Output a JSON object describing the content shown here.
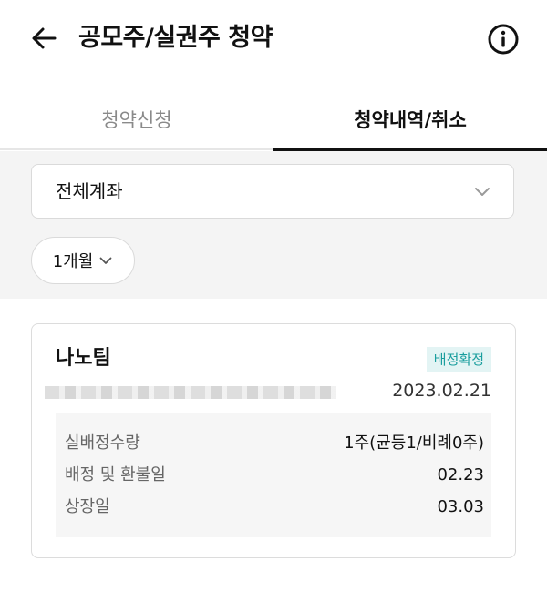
{
  "header": {
    "title": "공모주/실권주 청약",
    "back_icon": "arrow-left-icon",
    "info_icon": "info-circle-icon"
  },
  "tabs": [
    {
      "label": "청약신청",
      "active": false
    },
    {
      "label": "청약내역/취소",
      "active": true
    }
  ],
  "filters": {
    "account": "전체계좌",
    "period": "1개월"
  },
  "card": {
    "stock_name": "나노팀",
    "status": "배정확정",
    "date": "2023.02.21",
    "details": [
      {
        "label": "실배정수량",
        "value": "1주(균등1/비례0주)"
      },
      {
        "label": "배정 및 환불일",
        "value": "02.23"
      },
      {
        "label": "상장일",
        "value": "03.03"
      }
    ]
  },
  "colors": {
    "badge_bg": "#e3f4f4",
    "badge_text": "#1a9e9e",
    "tab_indicator": "#111111"
  }
}
